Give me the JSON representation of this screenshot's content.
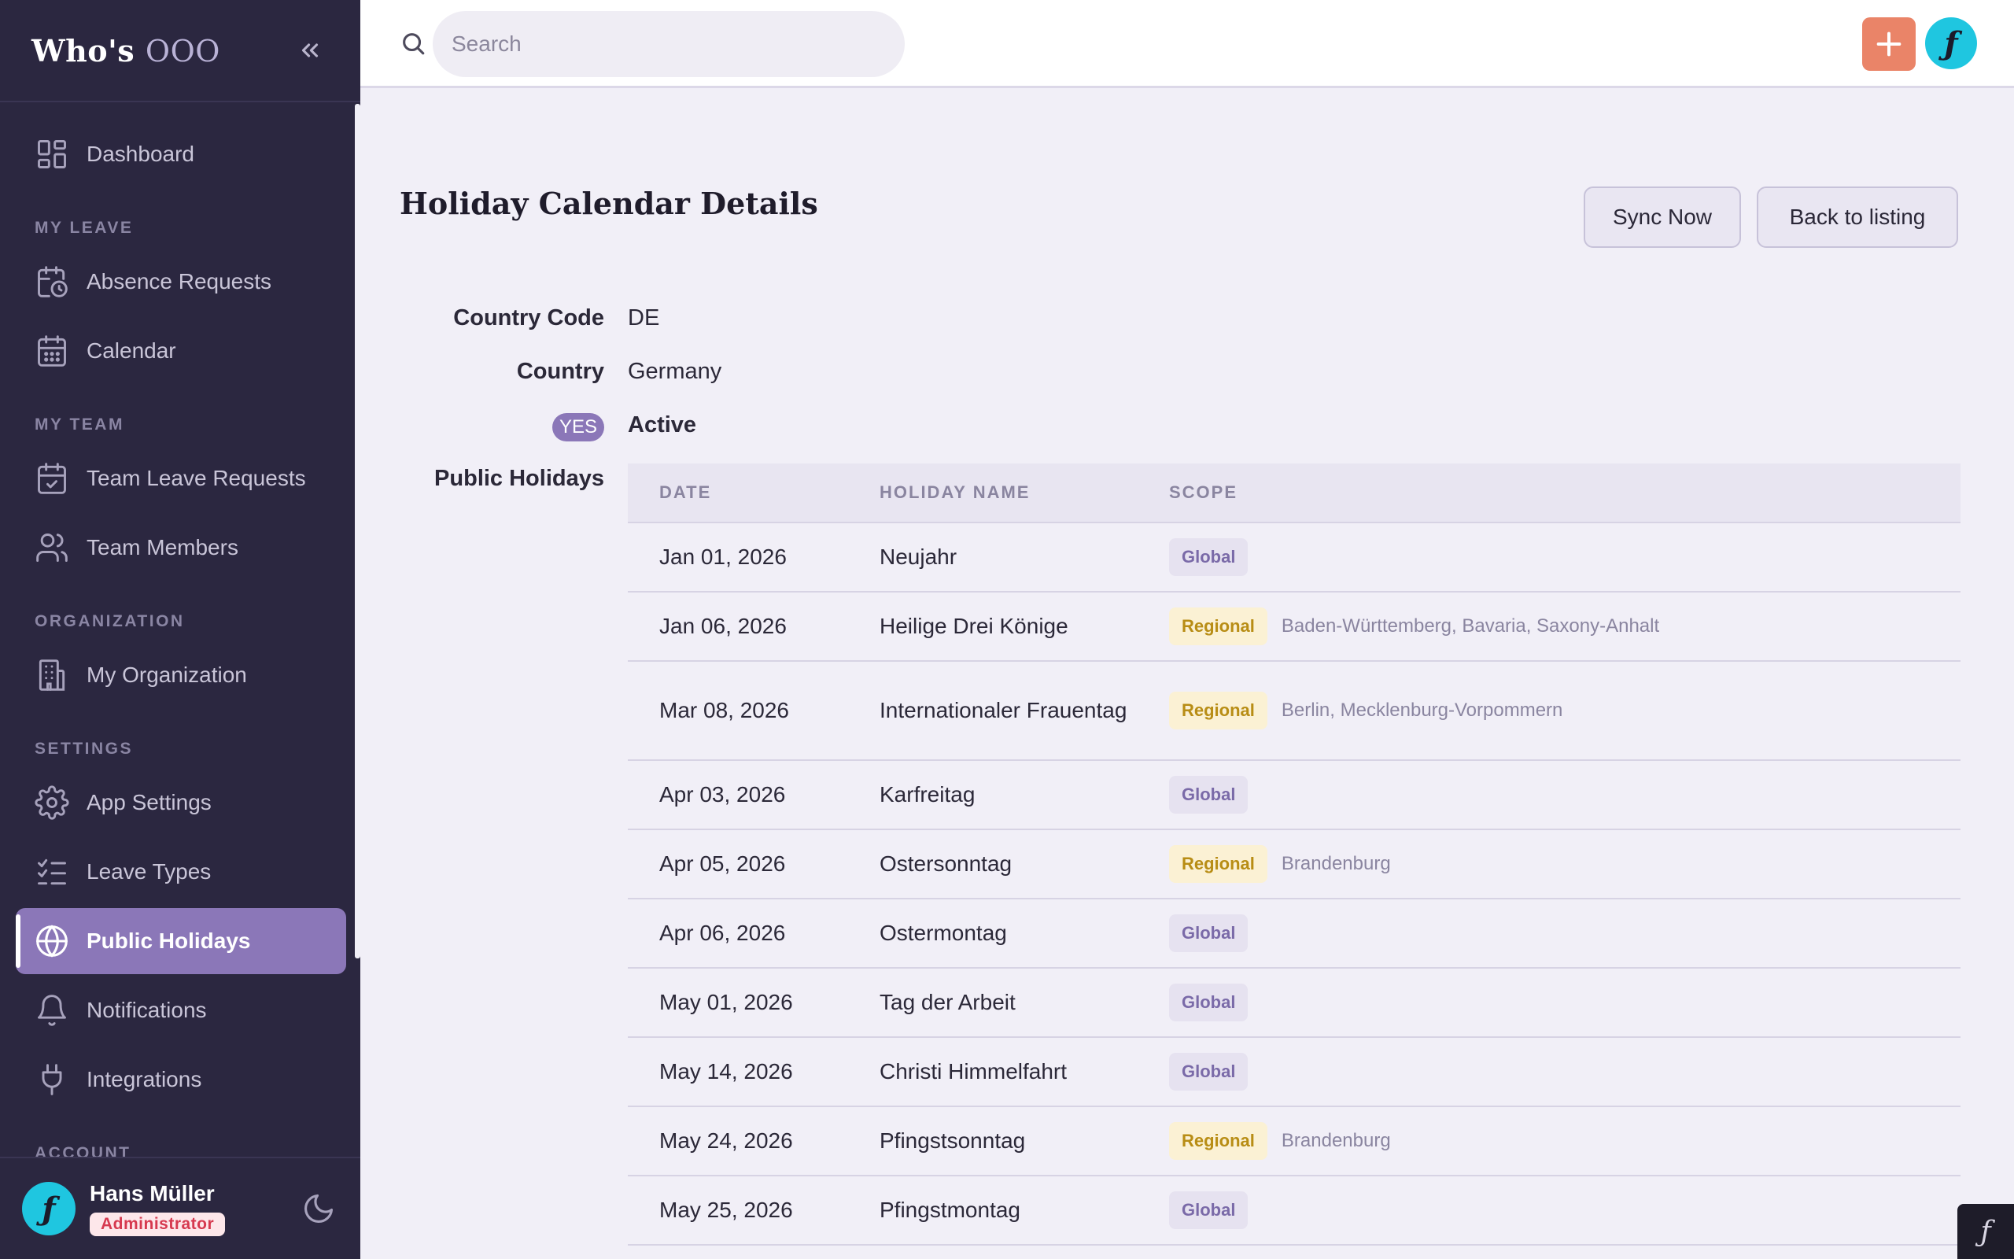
{
  "app": {
    "logo_main": "Who's",
    "logo_accent": "OOO"
  },
  "sidebar": {
    "items": [
      {
        "label": "Dashboard",
        "icon": "dashboard-icon"
      },
      {
        "section": "MY LEAVE"
      },
      {
        "label": "Absence Requests",
        "icon": "calendar-clock-icon"
      },
      {
        "label": "Calendar",
        "icon": "calendar-icon"
      },
      {
        "section": "MY TEAM"
      },
      {
        "label": "Team Leave Requests",
        "icon": "calendar-check-icon"
      },
      {
        "label": "Team Members",
        "icon": "users-icon"
      },
      {
        "section": "ORGANIZATION"
      },
      {
        "label": "My Organization",
        "icon": "building-icon"
      },
      {
        "section": "SETTINGS"
      },
      {
        "label": "App Settings",
        "icon": "gear-icon"
      },
      {
        "label": "Leave Types",
        "icon": "list-check-icon"
      },
      {
        "label": "Public Holidays",
        "icon": "globe-icon",
        "active": true
      },
      {
        "label": "Notifications",
        "icon": "bell-icon"
      },
      {
        "label": "Integrations",
        "icon": "plug-icon"
      },
      {
        "section": "ACCOUNT"
      }
    ],
    "user": {
      "name": "Hans Müller",
      "role": "Administrator"
    }
  },
  "topbar": {
    "search_placeholder": "Search"
  },
  "page": {
    "title": "Holiday Calendar Details",
    "sync_label": "Sync Now",
    "back_label": "Back to listing",
    "fields": {
      "country_code_label": "Country Code",
      "country_code": "DE",
      "country_label": "Country",
      "country": "Germany",
      "status_badge": "YES",
      "status": "Active",
      "holidays_label": "Public Holidays"
    },
    "table": {
      "headers": [
        "DATE",
        "HOLIDAY NAME",
        "SCOPE"
      ],
      "rows": [
        {
          "date": "Jan 01, 2026",
          "name": "Neujahr",
          "scope": "Global",
          "regions": ""
        },
        {
          "date": "Jan 06, 2026",
          "name": "Heilige Drei Könige",
          "scope": "Regional",
          "regions": "Baden-Württemberg, Bavaria, Saxony-Anhalt"
        },
        {
          "date": "Mar 08, 2026",
          "name": "Internationaler Frauentag",
          "scope": "Regional",
          "regions": "Berlin, Mecklenburg-Vorpommern"
        },
        {
          "date": "Apr 03, 2026",
          "name": "Karfreitag",
          "scope": "Global",
          "regions": ""
        },
        {
          "date": "Apr 05, 2026",
          "name": "Ostersonntag",
          "scope": "Regional",
          "regions": "Brandenburg"
        },
        {
          "date": "Apr 06, 2026",
          "name": "Ostermontag",
          "scope": "Global",
          "regions": ""
        },
        {
          "date": "May 01, 2026",
          "name": "Tag der Arbeit",
          "scope": "Global",
          "regions": ""
        },
        {
          "date": "May 14, 2026",
          "name": "Christi Himmelfahrt",
          "scope": "Global",
          "regions": ""
        },
        {
          "date": "May 24, 2026",
          "name": "Pfingstsonntag",
          "scope": "Regional",
          "regions": "Brandenburg"
        },
        {
          "date": "May 25, 2026",
          "name": "Pfingstmontag",
          "scope": "Global",
          "regions": ""
        }
      ]
    }
  },
  "colors": {
    "sidebar_bg": "#2b2740",
    "accent": "#8b77b8",
    "add_button": "#ea8468",
    "avatar": "#1fc6e0",
    "global_badge": "#7a6aa8",
    "regional_badge": "#b88d15"
  }
}
